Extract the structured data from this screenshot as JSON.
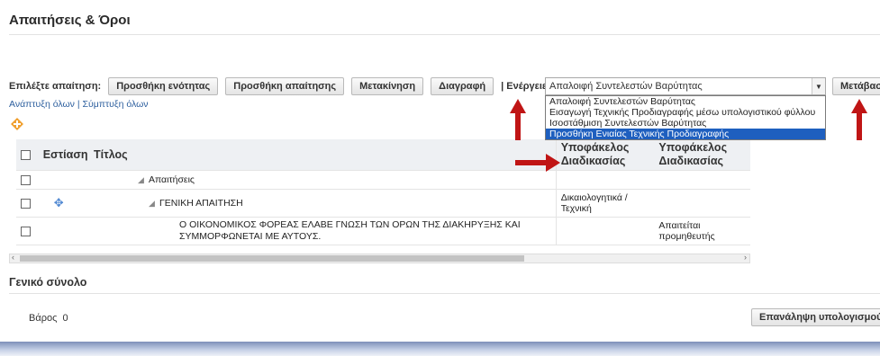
{
  "page": {
    "title": "Απαιτήσεις & Όροι"
  },
  "toolbar": {
    "select_label": "Επιλέξτε απαίτηση:",
    "add_section": "Προσθήκη ενότητας",
    "add_requirement": "Προσθήκη απαίτησης",
    "move": "Μετακίνηση",
    "delete": "Διαγραφή",
    "actions_label": "| Ενέργειες",
    "actions_selected": "Απαλοιφή Συντελεστών Βαρύτητας",
    "go": "Μετάβαση"
  },
  "dropdown": {
    "options": [
      "Απαλοιφή Συντελεστών Βαρύτητας",
      "Εισαγωγή Τεχνικής Προδιαγραφής μέσω υπολογιστικού φύλλου",
      "Ισοστάθμιση Συντελεστών Βαρύτητας",
      "Προσθήκη Ενιαίας Τεχνικής Προδιαγραφής"
    ],
    "highlighted_index": 3
  },
  "links": {
    "expand_all": "Ανάπτυξη όλων",
    "separator": " | ",
    "collapse_all": "Σύμπτυξη όλων"
  },
  "table": {
    "headers": {
      "focus": "Εστίαση",
      "title": "Τίτλος",
      "subfolder1": "Υποφάκελος Διαδικασίας",
      "subfolder2": "Υποφάκελος Διαδικασίας"
    },
    "rows": [
      {
        "title": "Απαιτήσεις",
        "subfolder1": "",
        "subfolder2": ""
      },
      {
        "title": "ΓΕΝΙΚΗ ΑΠΑΙΤΗΣΗ",
        "subfolder1": "Δικαιολογητικά / Τεχνική",
        "subfolder2": ""
      },
      {
        "title": "Ο ΟΙΚΟΝΟΜΙΚΟΣ ΦΟΡΕΑΣ ΕΛΑΒΕ ΓΝΩΣΗ ΤΩΝ ΟΡΩΝ ΤΗΣ ΔΙΑΚΗΡΥΞΗΣ ΚΑΙ ΣΥΜΜΟΡΦΩΝΕΤΑΙ ΜΕ ΑΥΤΟΥΣ.",
        "subfolder1": "",
        "subfolder2": "Απαιτείται προμηθευτής"
      }
    ]
  },
  "totals": {
    "title": "Γενικό σύνολο",
    "weight_label": "Βάρος",
    "weight_value": "0",
    "recalc": "Επανάληψη υπολογισμού"
  },
  "colors": {
    "annotation_arrow": "#c01515",
    "link": "#2d5f9e",
    "highlight": "#1e5fbf"
  },
  "icons": [
    "add-icon",
    "focus-diamond-icon",
    "collapse-triangle-icon",
    "dropdown-arrow-icon",
    "scroll-left-icon",
    "scroll-right-icon"
  ]
}
